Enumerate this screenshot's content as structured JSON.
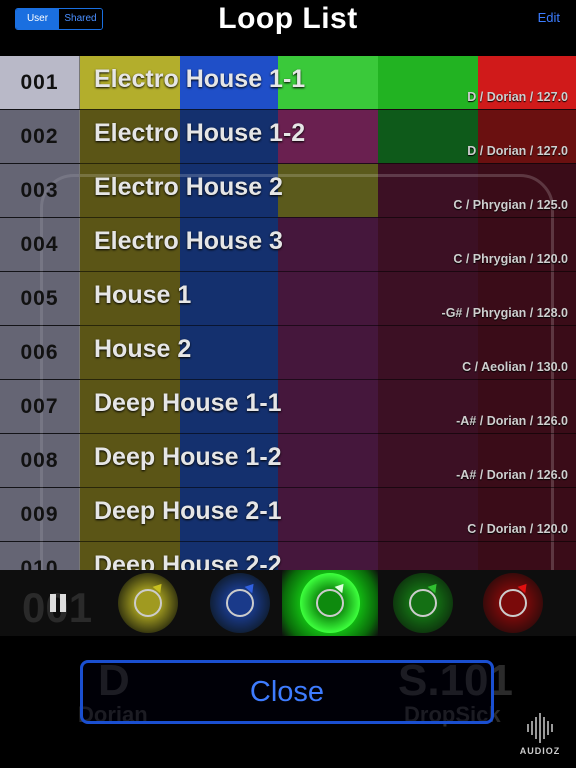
{
  "header": {
    "tabs": [
      {
        "label": "User",
        "active": true
      },
      {
        "label": "Shared",
        "active": false
      }
    ],
    "title": "Loop List",
    "edit_label": "Edit"
  },
  "colors": {
    "accent_blue": "#1a6fe0",
    "band_yellow": "#a9a52a",
    "band_blue": "#1a3f9e",
    "band_magenta": "#5a1f48",
    "band_dark_red": "#4a1624",
    "sel_green": "#3ac93a",
    "sel_red": "#d01a1a"
  },
  "loops": [
    {
      "number": "001",
      "name": "Electro House 1-1",
      "info": "D / Dorian / 127.0",
      "selected": true
    },
    {
      "number": "002",
      "name": "Electro House 1-2",
      "info": "D / Dorian / 127.0"
    },
    {
      "number": "003",
      "name": "Electro House 2",
      "info": "C / Phrygian / 125.0"
    },
    {
      "number": "004",
      "name": "Electro House 3",
      "info": "C / Phrygian / 120.0"
    },
    {
      "number": "005",
      "name": "House 1",
      "info": "-G# / Phrygian / 128.0"
    },
    {
      "number": "006",
      "name": "House 2",
      "info": "C / Aeolian / 130.0"
    },
    {
      "number": "007",
      "name": "Deep House 1-1",
      "info": "-A# / Dorian / 126.0"
    },
    {
      "number": "008",
      "name": "Deep House 1-2",
      "info": "-A# / Dorian / 126.0"
    },
    {
      "number": "009",
      "name": "Deep House 2-1",
      "info": "C / Dorian / 120.0"
    },
    {
      "number": "010",
      "name": "Deep House 2-2",
      "info": ""
    }
  ],
  "strip": {
    "loop_number": "001",
    "knobs": [
      {
        "name": "yellow",
        "color": "#a09a20",
        "ring": "#3a3a10",
        "pointer": "#c8c020"
      },
      {
        "name": "blue",
        "color": "#1a3a8a",
        "ring": "#10203a",
        "pointer": "#3060e0"
      },
      {
        "name": "green-active",
        "color": "#0e8a0e",
        "ring": "#3dff3d",
        "pointer": "#dfffdf"
      },
      {
        "name": "green",
        "color": "#147014",
        "ring": "#0e3a0e",
        "pointer": "#30c030"
      },
      {
        "name": "red",
        "color": "#7a0a0a",
        "ring": "#3a0a0a",
        "pointer": "#e01010"
      }
    ]
  },
  "background": {
    "key": "D",
    "scale": "Dorian",
    "preset": "S.101",
    "preset_name": "DropSick"
  },
  "close_label": "Close",
  "watermark": "AUDIOZ"
}
